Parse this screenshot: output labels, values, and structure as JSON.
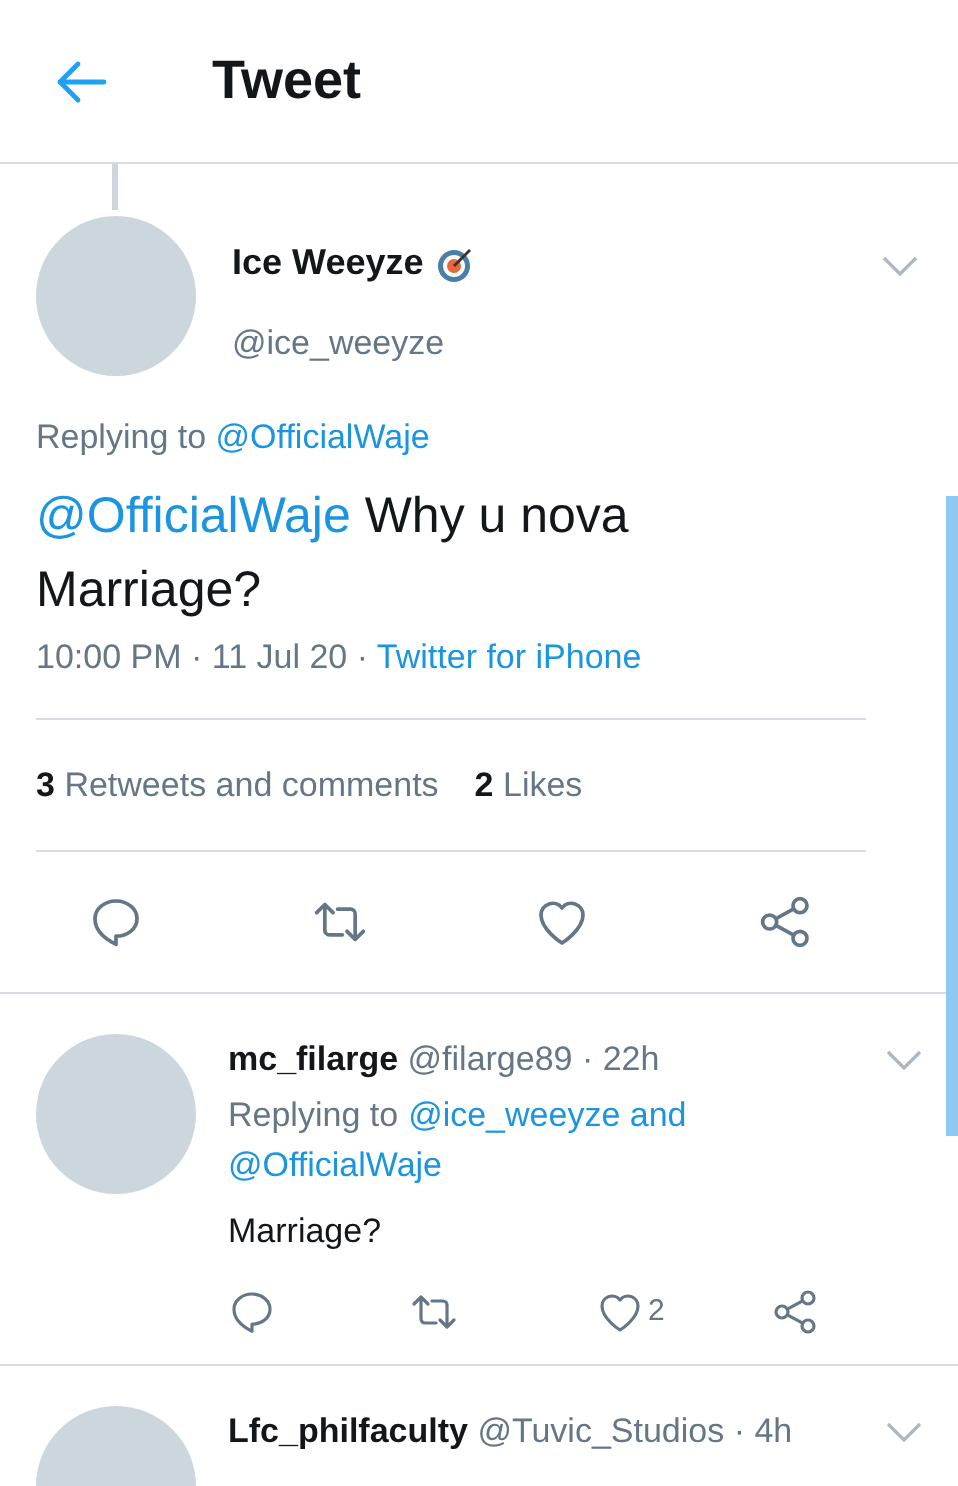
{
  "header": {
    "title": "Tweet"
  },
  "tweet": {
    "name": "Ice Weeyze",
    "handle": "@ice_weeyze",
    "replying_label": "Replying to",
    "replying_to": "@OfficialWaje",
    "mention": "@OfficialWaje",
    "text": "Why u nova Marriage?",
    "time": "10:00 PM · 11 Jul 20 · ",
    "source": "Twitter for iPhone",
    "retweets_count": "3",
    "retweets_label": "Retweets and comments",
    "likes_count": "2",
    "likes_label": "Likes"
  },
  "replies": [
    {
      "name": "mc_filarge",
      "handle": "@filarge89 · 22h",
      "replying_label": "Replying to",
      "replying_to_lines": [
        "@ice_weeyze and",
        "@OfficialWaje"
      ],
      "text": "Marriage?",
      "like_count": "2"
    },
    {
      "name": "Lfc_philfaculty",
      "handle": "@Tuvic_Studios · 4h"
    }
  ]
}
